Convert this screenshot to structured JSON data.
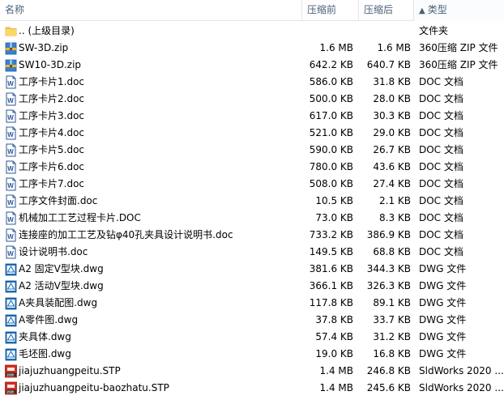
{
  "columns": {
    "name": "名称",
    "compressed": "压缩前",
    "uncompressed": "压缩后",
    "type": "类型",
    "sort_arrow": "▲"
  },
  "files": [
    {
      "name": ".. (上级目录)",
      "compressed": "",
      "uncompressed": "",
      "type": "文件夹",
      "icon": "folder-icon"
    },
    {
      "name": "SW-3D.zip",
      "compressed": "1.6 MB",
      "uncompressed": "1.6 MB",
      "type": "360压缩 ZIP 文件",
      "icon": "zip-archive-icon"
    },
    {
      "name": "SW10-3D.zip",
      "compressed": "642.2 KB",
      "uncompressed": "640.7 KB",
      "type": "360压缩 ZIP 文件",
      "icon": "zip-archive-icon"
    },
    {
      "name": "工序卡片1.doc",
      "compressed": "586.0 KB",
      "uncompressed": "31.8 KB",
      "type": "DOC 文档",
      "icon": "word-doc-icon"
    },
    {
      "name": "工序卡片2.doc",
      "compressed": "500.0 KB",
      "uncompressed": "28.0 KB",
      "type": "DOC 文档",
      "icon": "word-doc-icon"
    },
    {
      "name": "工序卡片3.doc",
      "compressed": "617.0 KB",
      "uncompressed": "30.3 KB",
      "type": "DOC 文档",
      "icon": "word-doc-icon"
    },
    {
      "name": "工序卡片4.doc",
      "compressed": "521.0 KB",
      "uncompressed": "29.0 KB",
      "type": "DOC 文档",
      "icon": "word-doc-icon"
    },
    {
      "name": "工序卡片5.doc",
      "compressed": "590.0 KB",
      "uncompressed": "26.7 KB",
      "type": "DOC 文档",
      "icon": "word-doc-icon"
    },
    {
      "name": "工序卡片6.doc",
      "compressed": "780.0 KB",
      "uncompressed": "43.6 KB",
      "type": "DOC 文档",
      "icon": "word-doc-icon"
    },
    {
      "name": "工序卡片7.doc",
      "compressed": "508.0 KB",
      "uncompressed": "27.4 KB",
      "type": "DOC 文档",
      "icon": "word-doc-icon"
    },
    {
      "name": "工序文件封面.doc",
      "compressed": "10.5 KB",
      "uncompressed": "2.1 KB",
      "type": "DOC 文档",
      "icon": "word-doc-icon"
    },
    {
      "name": "机械加工工艺过程卡片.DOC",
      "compressed": "73.0 KB",
      "uncompressed": "8.3 KB",
      "type": "DOC 文档",
      "icon": "word-doc-icon"
    },
    {
      "name": "连接座的加工工艺及钻φ40孔夹具设计说明书.doc",
      "compressed": "733.2 KB",
      "uncompressed": "386.9 KB",
      "type": "DOC 文档",
      "icon": "word-doc-icon"
    },
    {
      "name": "设计说明书.doc",
      "compressed": "149.5 KB",
      "uncompressed": "68.8 KB",
      "type": "DOC 文档",
      "icon": "word-doc-icon"
    },
    {
      "name": "A2 固定V型块.dwg",
      "compressed": "381.6 KB",
      "uncompressed": "344.3 KB",
      "type": "DWG 文件",
      "icon": "dwg-file-icon"
    },
    {
      "name": "A2 活动V型块.dwg",
      "compressed": "366.1 KB",
      "uncompressed": "326.3 KB",
      "type": "DWG 文件",
      "icon": "dwg-file-icon"
    },
    {
      "name": "A夹具装配图.dwg",
      "compressed": "117.8 KB",
      "uncompressed": "89.1 KB",
      "type": "DWG 文件",
      "icon": "dwg-file-icon"
    },
    {
      "name": "A零件图.dwg",
      "compressed": "37.8 KB",
      "uncompressed": "33.7 KB",
      "type": "DWG 文件",
      "icon": "dwg-file-icon"
    },
    {
      "name": "夹具体.dwg",
      "compressed": "57.4 KB",
      "uncompressed": "31.2 KB",
      "type": "DWG 文件",
      "icon": "dwg-file-icon"
    },
    {
      "name": "毛坯图.dwg",
      "compressed": "19.0 KB",
      "uncompressed": "16.8 KB",
      "type": "DWG 文件",
      "icon": "dwg-file-icon"
    },
    {
      "name": "jiajuzhuangpeitu.STP",
      "compressed": "1.4 MB",
      "uncompressed": "246.8 KB",
      "type": "SldWorks 2020 ...",
      "icon": "solidworks-stp-icon"
    },
    {
      "name": "jiajuzhuangpeitu-baozhatu.STP",
      "compressed": "1.4 MB",
      "uncompressed": "245.6 KB",
      "type": "SldWorks 2020 ...",
      "icon": "solidworks-stp-icon"
    }
  ]
}
